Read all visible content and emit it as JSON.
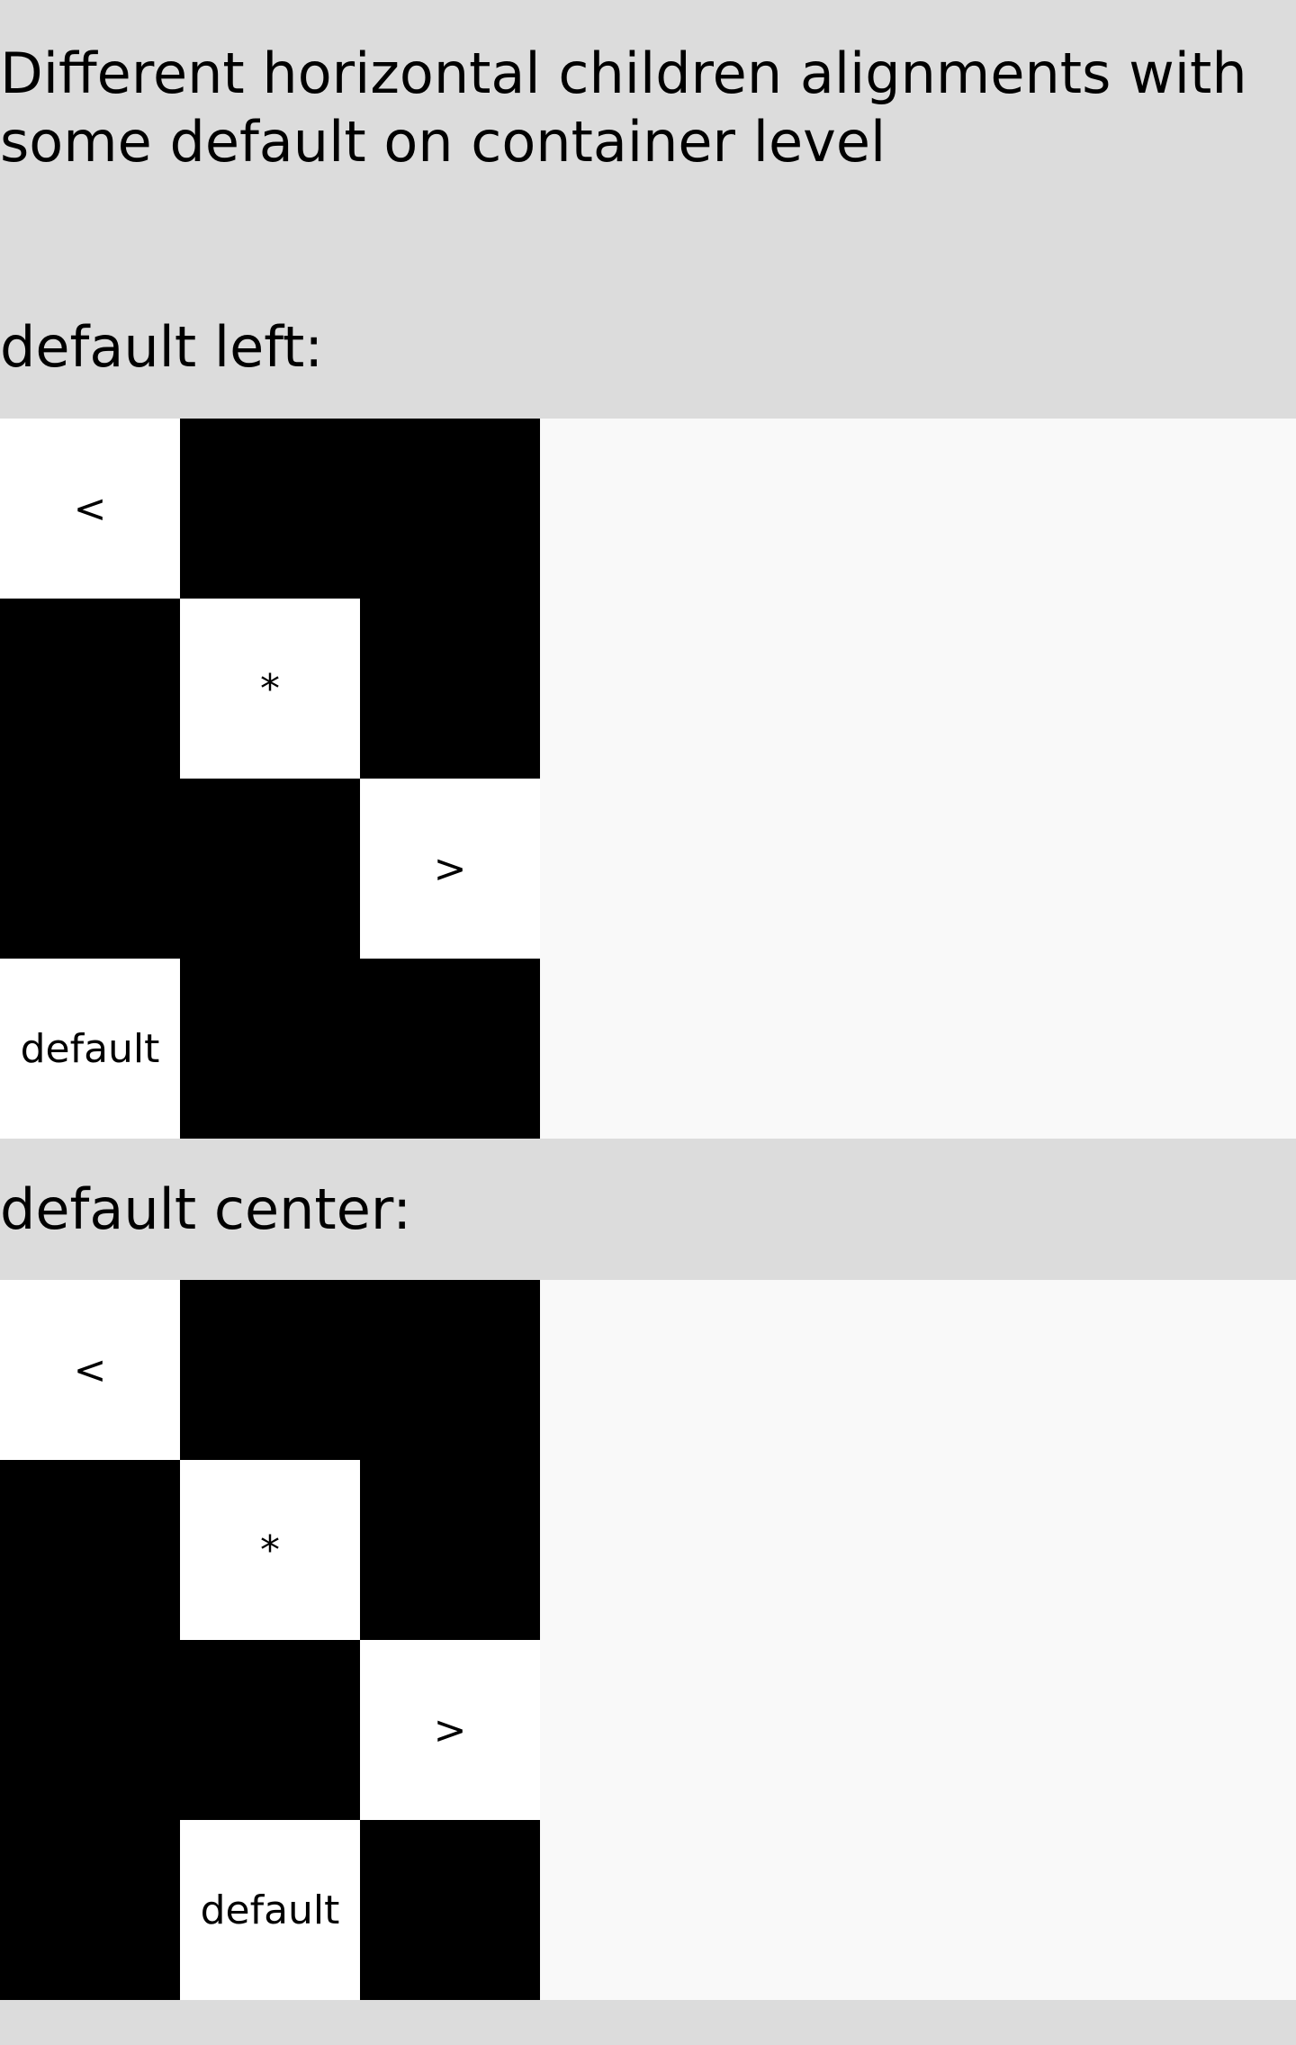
{
  "page": {
    "title": "Different horizontal children alignments with some default on container level"
  },
  "sections": [
    {
      "label": "default left:",
      "items": [
        {
          "text": "<",
          "align": "left"
        },
        {
          "text": "*",
          "align": "center"
        },
        {
          "text": ">",
          "align": "right"
        },
        {
          "text": "default",
          "align": "left"
        }
      ]
    },
    {
      "label": "default center:",
      "items": [
        {
          "text": "<",
          "align": "left"
        },
        {
          "text": "*",
          "align": "center"
        },
        {
          "text": ">",
          "align": "right"
        },
        {
          "text": "default",
          "align": "center"
        }
      ]
    }
  ],
  "colors": {
    "page_background": "#dcdcdc",
    "container_background": "#f9f9f9",
    "row_background": "#000000",
    "cell_background": "#ffffff"
  }
}
